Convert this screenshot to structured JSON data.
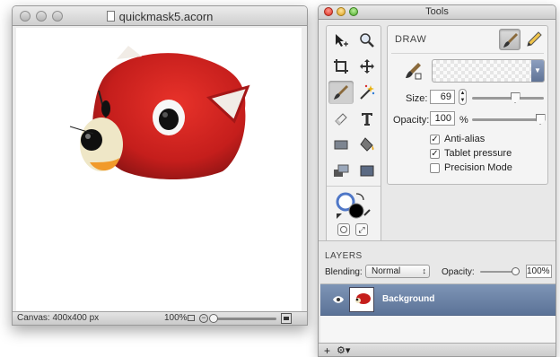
{
  "document_window": {
    "title": "quickmask5.acorn",
    "status": {
      "canvas_size": "Canvas: 400x400 px",
      "zoom": "100%"
    }
  },
  "tools_window": {
    "title": "Tools",
    "tools": [
      {
        "name": "select-move",
        "icon": "arrow-cursor-icon"
      },
      {
        "name": "zoom",
        "icon": "magnifier-icon"
      },
      {
        "name": "crop",
        "icon": "crop-icon"
      },
      {
        "name": "move",
        "icon": "four-arrow-icon"
      },
      {
        "name": "brush",
        "icon": "brush-icon",
        "selected": true
      },
      {
        "name": "magic-wand",
        "icon": "magic-wand-icon"
      },
      {
        "name": "eraser",
        "icon": "eraser-icon"
      },
      {
        "name": "text",
        "icon": "text-icon"
      },
      {
        "name": "rectangle",
        "icon": "rectangle-icon"
      },
      {
        "name": "paint-bucket",
        "icon": "paint-bucket-icon"
      },
      {
        "name": "gradient",
        "icon": "gradient-icon"
      },
      {
        "name": "shape",
        "icon": "shape-icon"
      }
    ],
    "colors": {
      "fill": "#ffffff",
      "stroke": "#000000",
      "accent": "#4f77c7"
    },
    "draw": {
      "header": "DRAW",
      "size_label": "Size:",
      "size_value": "69",
      "size_slider": 0.6,
      "opacity_label": "Opacity:",
      "opacity_value": "100",
      "opacity_unit": "%",
      "opacity_slider": 1.0,
      "checkboxes": [
        {
          "label": "Anti-alias",
          "checked": true
        },
        {
          "label": "Tablet pressure",
          "checked": true
        },
        {
          "label": "Precision Mode",
          "checked": false
        }
      ]
    },
    "layers": {
      "title": "LAYERS",
      "blending_label": "Blending:",
      "blending_value": "Normal",
      "opacity_label": "Opacity:",
      "opacity_value": "100%",
      "opacity_slider": 0.9,
      "items": [
        {
          "name": "Background",
          "visible": true,
          "selected": true
        }
      ],
      "footer": {
        "add": "+",
        "gear": "⚙▾"
      }
    }
  }
}
